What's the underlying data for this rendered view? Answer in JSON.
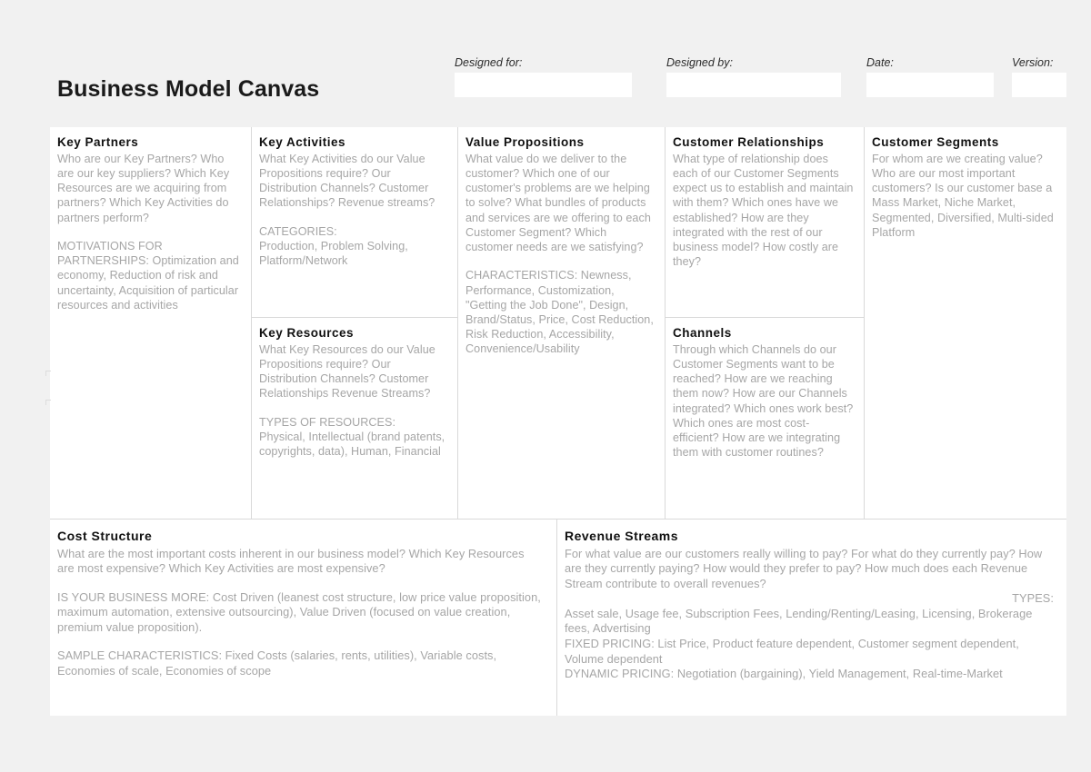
{
  "header": {
    "title": "Business Model Canvas",
    "fields": [
      {
        "label": "Designed for:",
        "value": "",
        "placeholder": ""
      },
      {
        "label": "Designed by:",
        "value": "",
        "placeholder": ""
      },
      {
        "label": "Date:",
        "value": "",
        "placeholder": ""
      },
      {
        "label": "Version:",
        "value": "",
        "placeholder": ""
      }
    ]
  },
  "blocks": {
    "key_partners": {
      "title": "Key Partners",
      "questions": "Who are our Key Partners? Who are our key suppliers? Which Key Resources are we acquiring from partners? Which Key Activities do partners perform?",
      "notes": "MOTIVATIONS FOR PARTNERSHIPS: Optimization and economy, Reduction of risk and uncertainty, Acquisition of particular resources and activities"
    },
    "key_activities": {
      "title": "Key Activities",
      "questions": "What Key Activities do our Value Propositions require? Our Distribution Channels? Customer Relationships? Revenue streams?",
      "notes_heading": "CATEGORIES:",
      "notes": "Production, Problem Solving, Platform/Network"
    },
    "key_resources": {
      "title": "Key Resources",
      "questions": "What Key Resources do our Value Propositions require? Our Distribution Channels? Customer Relationships Revenue Streams?",
      "notes_heading": "TYPES OF RESOURCES:",
      "notes": "Physical, Intellectual (brand patents, copyrights, data), Human, Financial"
    },
    "value_propositions": {
      "title": "Value Propositions",
      "questions": "What value do we deliver to the customer? Which one of our customer's problems are we helping to solve? What bundles of products and services are we offering to each Customer Segment? Which customer needs are we satisfying?",
      "notes": "CHARACTERISTICS: Newness, Performance, Customization, \"Getting the Job Done\", Design, Brand/Status, Price, Cost Reduction, Risk Reduction, Accessibility, Convenience/Usability"
    },
    "customer_relationships": {
      "title": "Customer Relationships",
      "questions": "What type of relationship does each of our Customer Segments expect us to establish and maintain with them? Which ones have we established? How are they integrated with the rest of our business model? How costly are they?"
    },
    "channels": {
      "title": "Channels",
      "questions": "Through which Channels do our Customer Segments want to be reached? How are we reaching them now? How are our Channels integrated? Which ones work best? Which ones are most cost-efficient? How are we integrating them with customer routines?"
    },
    "customer_segments": {
      "title": "Customer Segments",
      "questions": "For whom are we creating value? Who are our most important customers? Is our customer base a Mass Market, Niche Market, Segmented, Diversified, Multi-sided Platform"
    },
    "cost_structure": {
      "title": "Cost Structure",
      "questions": "What are the most important costs inherent in our business model? Which Key Resources are most expensive? Which Key Activities are most expensive?",
      "notes_1": "IS YOUR BUSINESS MORE: Cost Driven (leanest cost structure, low price value proposition, maximum automation, extensive outsourcing), Value Driven (focused on value creation, premium value proposition).",
      "notes_2": "SAMPLE CHARACTERISTICS: Fixed Costs (salaries, rents, utilities), Variable costs, Economies of scale, Economies of scope"
    },
    "revenue_streams": {
      "title": "Revenue Streams",
      "questions": "For what value are our customers really willing to pay? For what do they currently pay? How are they currently paying? How would they prefer to pay? How much does each Revenue Stream contribute to overall revenues?",
      "types_label": "TYPES:",
      "types_list": "Asset sale, Usage fee, Subscription Fees, Lending/Renting/Leasing, Licensing, Brokerage fees, Advertising",
      "fixed_pricing": "FIXED PRICING: List Price, Product feature dependent, Customer segment dependent, Volume dependent",
      "dynamic_pricing": "DYNAMIC PRICING: Negotiation (bargaining), Yield Management, Real-time-Market"
    }
  },
  "colors": {
    "page_background": "#f1f1f1",
    "canvas_background": "#ffffff",
    "grid_line": "#d9d9d9",
    "heading_text": "#111111",
    "body_text": "#a6a6a6"
  }
}
